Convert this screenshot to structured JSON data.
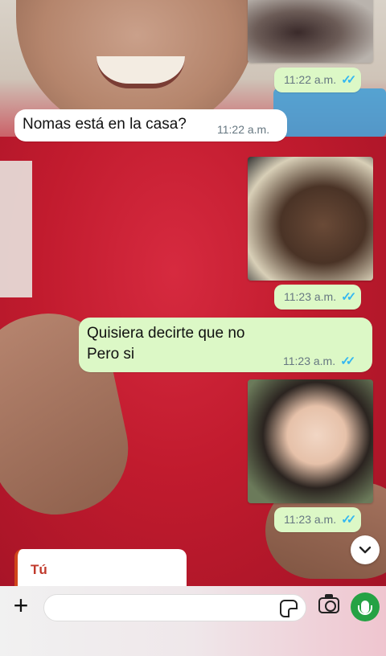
{
  "chat": {
    "messages": [
      {
        "type": "image",
        "direction": "out",
        "time": "11:22 a.m.",
        "status": "read"
      },
      {
        "type": "text",
        "direction": "in",
        "text": "Nomas está en la casa?",
        "time": "11:22 a.m."
      },
      {
        "type": "image",
        "direction": "out",
        "time": "11:23 a.m.",
        "status": "read"
      },
      {
        "type": "text",
        "direction": "out",
        "lines": [
          "Quisiera decirte que no",
          "Pero si"
        ],
        "time": "11:23 a.m.",
        "status": "read"
      },
      {
        "type": "image",
        "direction": "out",
        "time": "11:23 a.m.",
        "status": "read"
      }
    ]
  },
  "reply_preview": {
    "author": "Tú"
  },
  "composer": {
    "placeholder": ""
  },
  "icons": {
    "read_ticks": "double-check-icon",
    "scroll": "chevron-down-icon",
    "add": "plus-icon",
    "sticker": "sticker-icon",
    "camera": "camera-icon",
    "mic": "microphone-icon"
  },
  "colors": {
    "outgoing_bubble": "#dcf8c6",
    "incoming_bubble": "#ffffff",
    "read_ticks": "#34b7f1",
    "mic_button": "#25a244"
  }
}
